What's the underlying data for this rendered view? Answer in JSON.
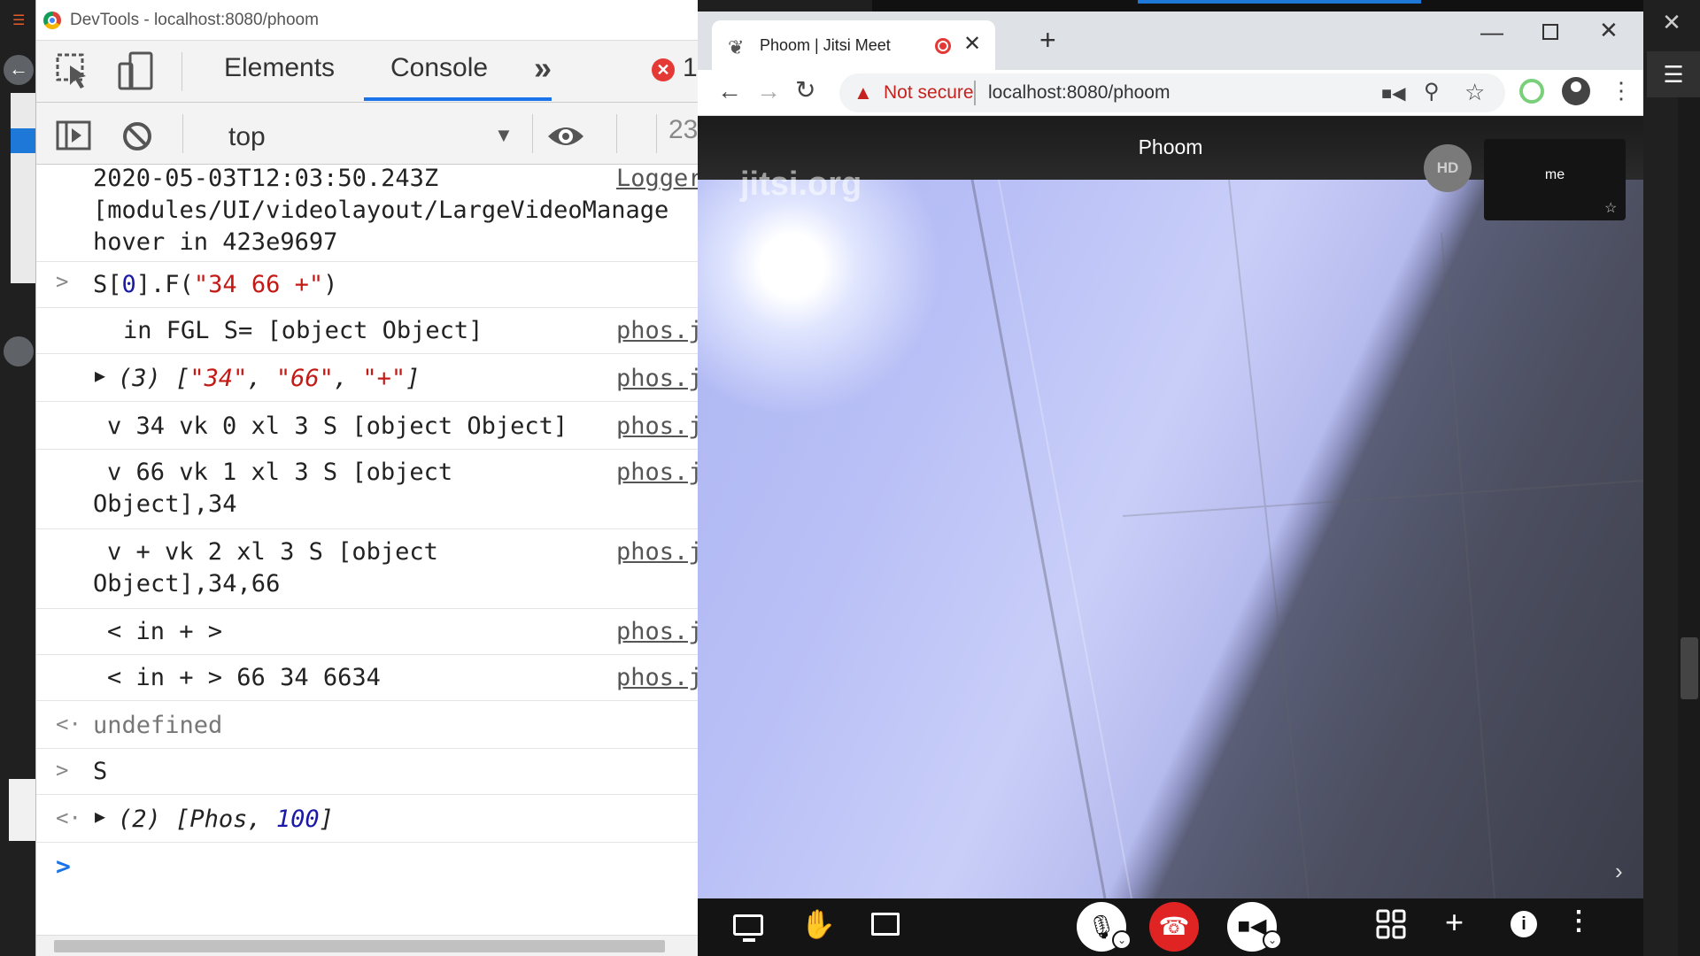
{
  "devtools": {
    "window_title": "DevTools - localhost:8080/phoom",
    "tabs": {
      "elements": "Elements",
      "console": "Console",
      "more": "»"
    },
    "error_count": "1",
    "context": "top",
    "message_count": "23",
    "console_rows": [
      {
        "text": "2020-05-03T12:03:50.243Z",
        "source": "Logger.j"
      },
      {
        "text": "[modules/UI/videolayout/LargeVideoManage"
      },
      {
        "text": "hover in 423e9697"
      },
      {
        "input_prefix": "S[",
        "input_index": "0",
        "input_mid": "].F(",
        "input_arg": "\"34 66 +\"",
        "input_suffix": ")"
      },
      {
        "text": "in FGL S= [object Object]",
        "source": "phos.j"
      },
      {
        "count": "(3)",
        "open": "[",
        "items": [
          "\"34\"",
          "\"66\"",
          "\"+\""
        ],
        "close": "]",
        "source": "phos.j"
      },
      {
        "text": "v 34 vk 0 xl 3 S [object Object]",
        "source": "phos.j"
      },
      {
        "text": "v 66 vk 1 xl 3 S [object",
        "text2": "Object],34",
        "source": "phos.j"
      },
      {
        "text": "v + vk 2 xl 3 S [object",
        "text2": "Object],34,66",
        "source": "phos.j"
      },
      {
        "text": "< in + >",
        "source": "phos.j"
      },
      {
        "text": "< in + > 66 34 6634",
        "source": "phos.j"
      },
      {
        "text": "undefined"
      },
      {
        "text": "S"
      },
      {
        "count": "(2)",
        "open": "[",
        "item0": "Phos",
        "item1": "100",
        "close": "]"
      }
    ]
  },
  "browser": {
    "tab_title": "Phoom | Jitsi Meet",
    "security_label": "Not secure",
    "url": "localhost:8080/phoom"
  },
  "meeting": {
    "room_name": "Phoom",
    "watermark": "jitsi.org",
    "quality_badge": "HD",
    "self_label": "me"
  },
  "colors": {
    "devtools_accent": "#1a73e8",
    "error_red": "#e53935",
    "hangup_red": "#e02424",
    "string_red": "#c41a16",
    "number_blue": "#1a1aa6"
  }
}
